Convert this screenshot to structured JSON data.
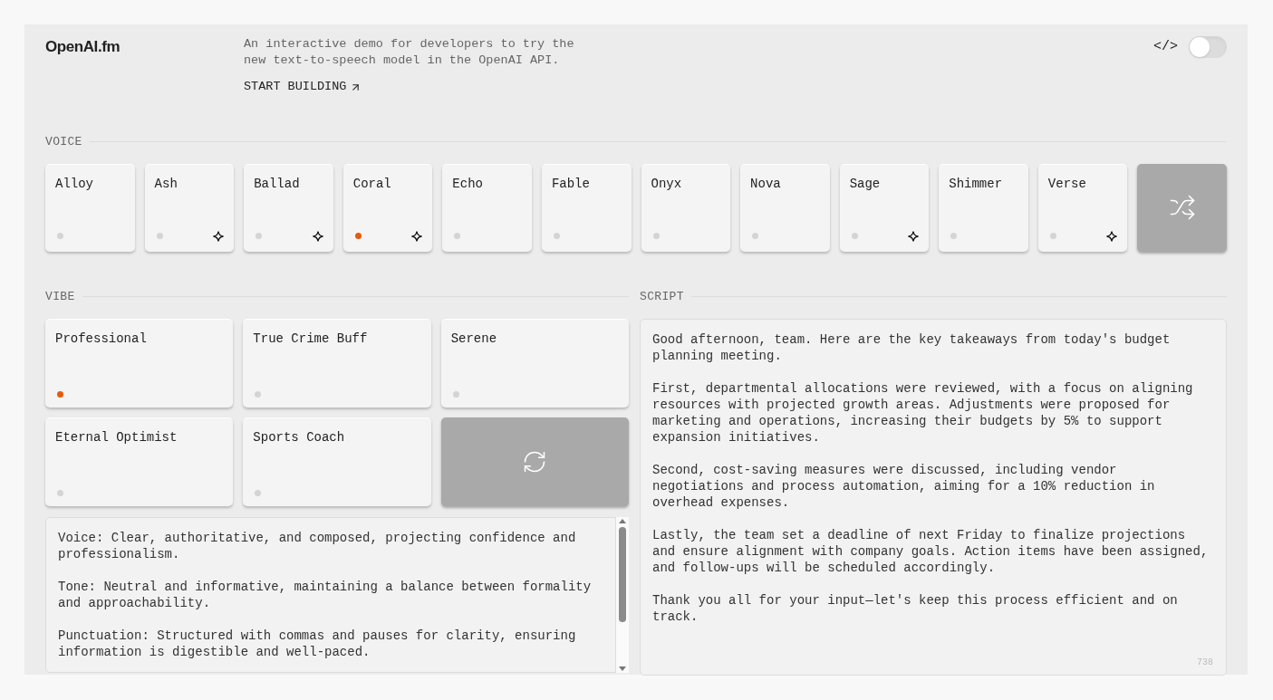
{
  "header": {
    "logo": "OpenAI.fm",
    "description": [
      "An interactive demo for developers to try the",
      "new text-to-speech model in the OpenAI API."
    ],
    "link": "START BUILDING",
    "code_toggle": {
      "label": "</>",
      "on": false
    }
  },
  "voice": {
    "label": "VOICE",
    "items": [
      {
        "name": "Alloy",
        "selected": false,
        "featured": false
      },
      {
        "name": "Ash",
        "selected": false,
        "featured": true
      },
      {
        "name": "Ballad",
        "selected": false,
        "featured": true
      },
      {
        "name": "Coral",
        "selected": true,
        "featured": true
      },
      {
        "name": "Echo",
        "selected": false,
        "featured": false
      },
      {
        "name": "Fable",
        "selected": false,
        "featured": false
      },
      {
        "name": "Onyx",
        "selected": false,
        "featured": false
      },
      {
        "name": "Nova",
        "selected": false,
        "featured": false
      },
      {
        "name": "Sage",
        "selected": false,
        "featured": true
      },
      {
        "name": "Shimmer",
        "selected": false,
        "featured": false
      },
      {
        "name": "Verse",
        "selected": false,
        "featured": true
      }
    ]
  },
  "vibe": {
    "label": "VIBE",
    "items": [
      {
        "name": "Professional",
        "selected": true
      },
      {
        "name": "True Crime Buff",
        "selected": false
      },
      {
        "name": "Serene",
        "selected": false
      },
      {
        "name": "Eternal Optimist",
        "selected": false
      },
      {
        "name": "Sports Coach",
        "selected": false
      }
    ],
    "instructions": [
      "Voice: Clear, authoritative, and composed, projecting confidence and professionalism.",
      "Tone: Neutral and informative, maintaining a balance between formality and approachability.",
      "Punctuation: Structured with commas and pauses for clarity, ensuring information is digestible and well-paced."
    ]
  },
  "script": {
    "label": "SCRIPT",
    "paragraphs": [
      "Good afternoon, team. Here are the key takeaways from today's budget planning meeting.",
      "First, departmental allocations were reviewed, with a focus on aligning resources with projected growth areas. Adjustments were proposed for marketing and operations, increasing their budgets by 5% to support expansion initiatives.",
      "Second, cost-saving measures were discussed, including vendor negotiations and process automation, aiming for a 10% reduction in overhead expenses.",
      "Lastly, the team set a deadline of next Friday to finalize projections and ensure alignment with company goals. Action items have been assigned, and follow-ups will be scheduled accordingly.",
      "Thank you all for your input—let's keep this process efficient and on track."
    ],
    "count": "738"
  }
}
